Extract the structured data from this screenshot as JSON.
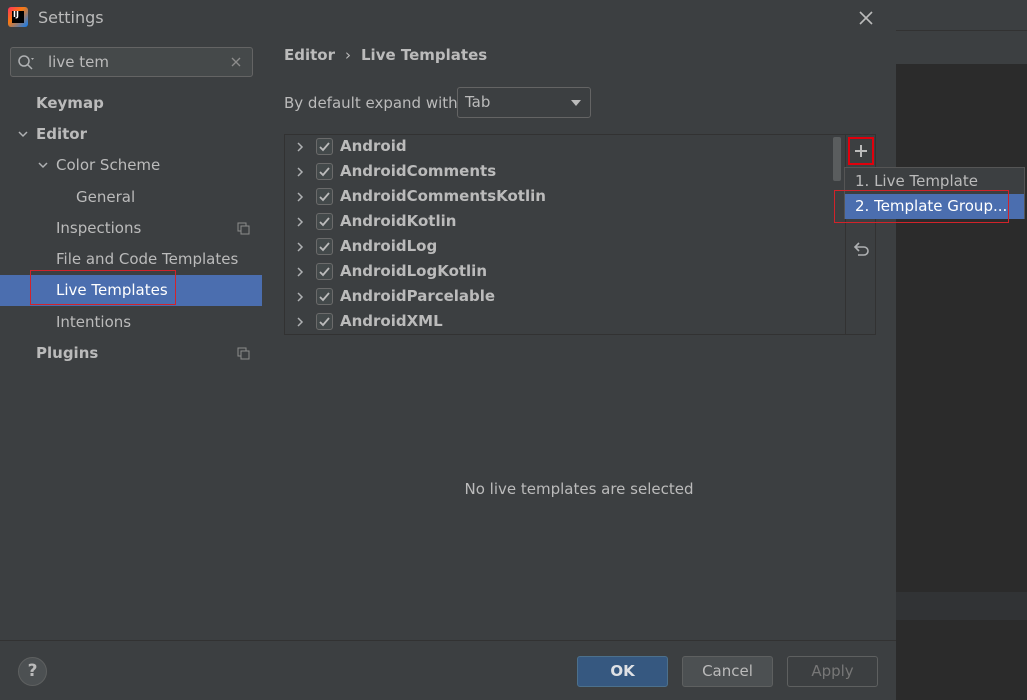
{
  "window": {
    "title": "Settings"
  },
  "search": {
    "value": "live tem"
  },
  "sidebar": {
    "items": [
      {
        "label": "Keymap"
      },
      {
        "label": "Editor"
      },
      {
        "label": "Color Scheme"
      },
      {
        "label": "General"
      },
      {
        "label": "Inspections"
      },
      {
        "label": "File and Code Templates"
      },
      {
        "label": "Live Templates"
      },
      {
        "label": "Intentions"
      },
      {
        "label": "Plugins"
      }
    ]
  },
  "breadcrumb": {
    "parent": "Editor",
    "separator": "›",
    "current": "Live Templates"
  },
  "expand": {
    "label": "By default expand with",
    "value": "Tab"
  },
  "templates": [
    {
      "name": "Android",
      "checked": true
    },
    {
      "name": "AndroidComments",
      "checked": true
    },
    {
      "name": "AndroidCommentsKotlin",
      "checked": true
    },
    {
      "name": "AndroidKotlin",
      "checked": true
    },
    {
      "name": "AndroidLog",
      "checked": true
    },
    {
      "name": "AndroidLogKotlin",
      "checked": true
    },
    {
      "name": "AndroidParcelable",
      "checked": true
    },
    {
      "name": "AndroidXML",
      "checked": true
    }
  ],
  "popup": {
    "items": [
      {
        "label": "1. Live Template"
      },
      {
        "label": "2. Template Group..."
      }
    ]
  },
  "empty_message": "No live templates are selected",
  "footer": {
    "help": "?",
    "ok": "OK",
    "cancel": "Cancel",
    "apply": "Apply"
  },
  "colors": {
    "selection": "#4b6eaf",
    "highlight_border": "#d1232a",
    "primary_button": "#365880"
  }
}
